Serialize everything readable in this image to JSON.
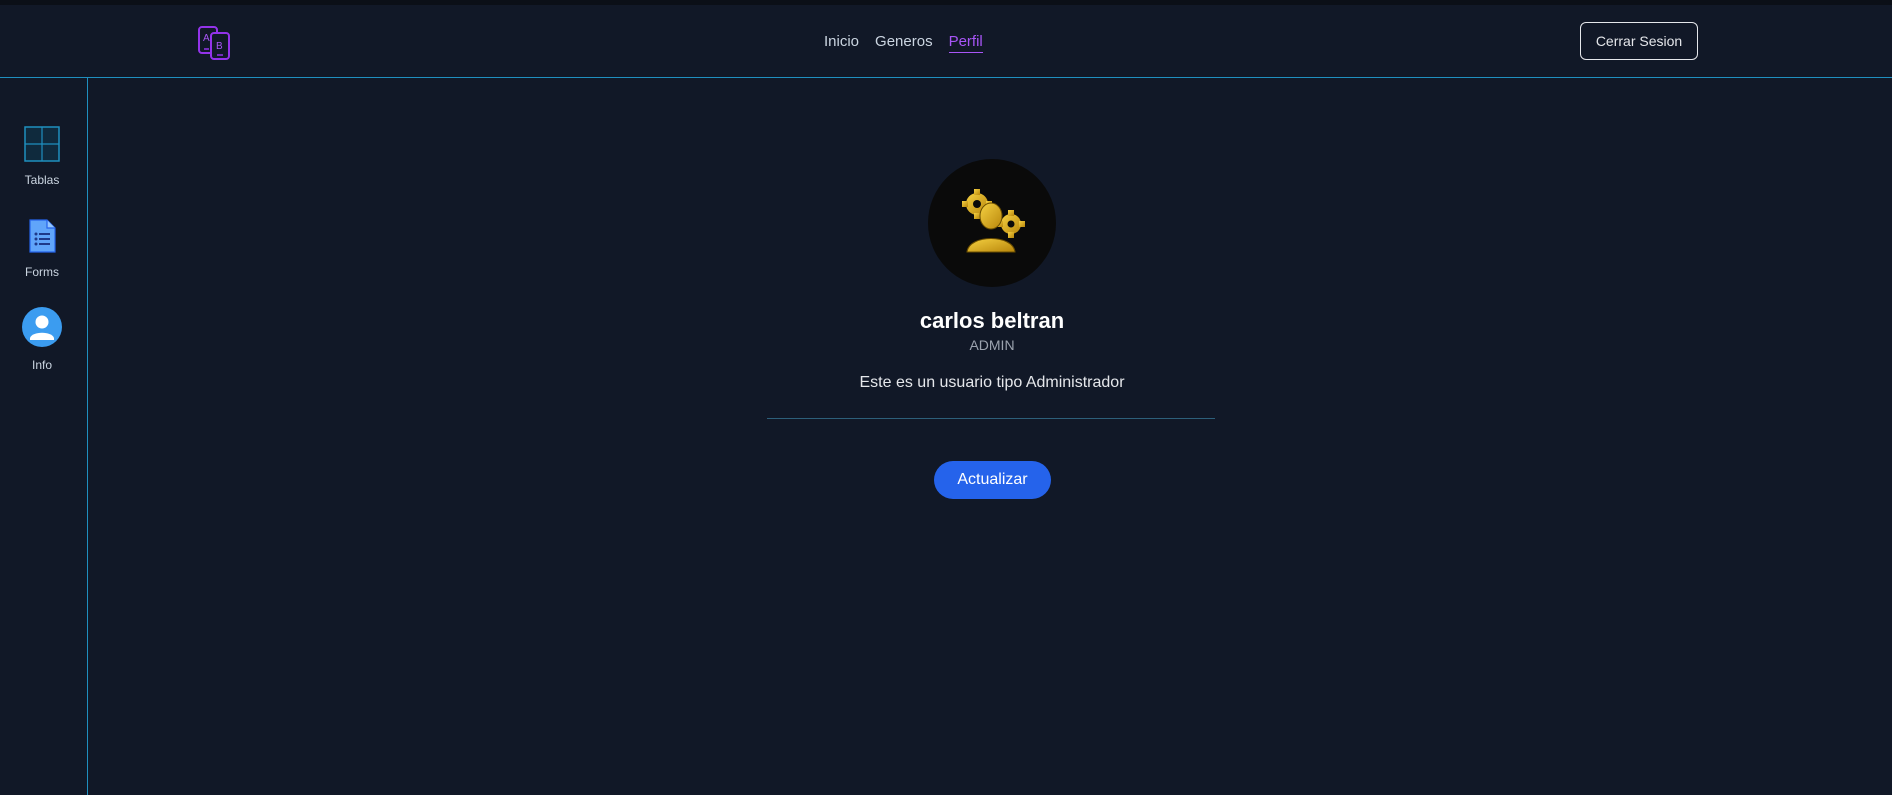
{
  "navbar": {
    "links": [
      {
        "label": "Inicio",
        "active": false
      },
      {
        "label": "Generos",
        "active": false
      },
      {
        "label": "Perfil",
        "active": true
      }
    ],
    "logout_label": "Cerrar Sesion",
    "active_color": "#a855f7"
  },
  "sidebar": {
    "items": [
      {
        "label": "Tablas",
        "icon": "grid-icon"
      },
      {
        "label": "Forms",
        "icon": "document-icon"
      },
      {
        "label": "Info",
        "icon": "user-circle-icon"
      }
    ]
  },
  "profile": {
    "name": "carlos beltran",
    "role": "ADMIN",
    "description": "Este es un usuario tipo Administrador",
    "update_label": "Actualizar",
    "avatar_icon": "admin-gears-icon"
  },
  "colors": {
    "background": "#111827",
    "accent_border": "#1f8fbf",
    "button_primary": "#2563eb"
  }
}
